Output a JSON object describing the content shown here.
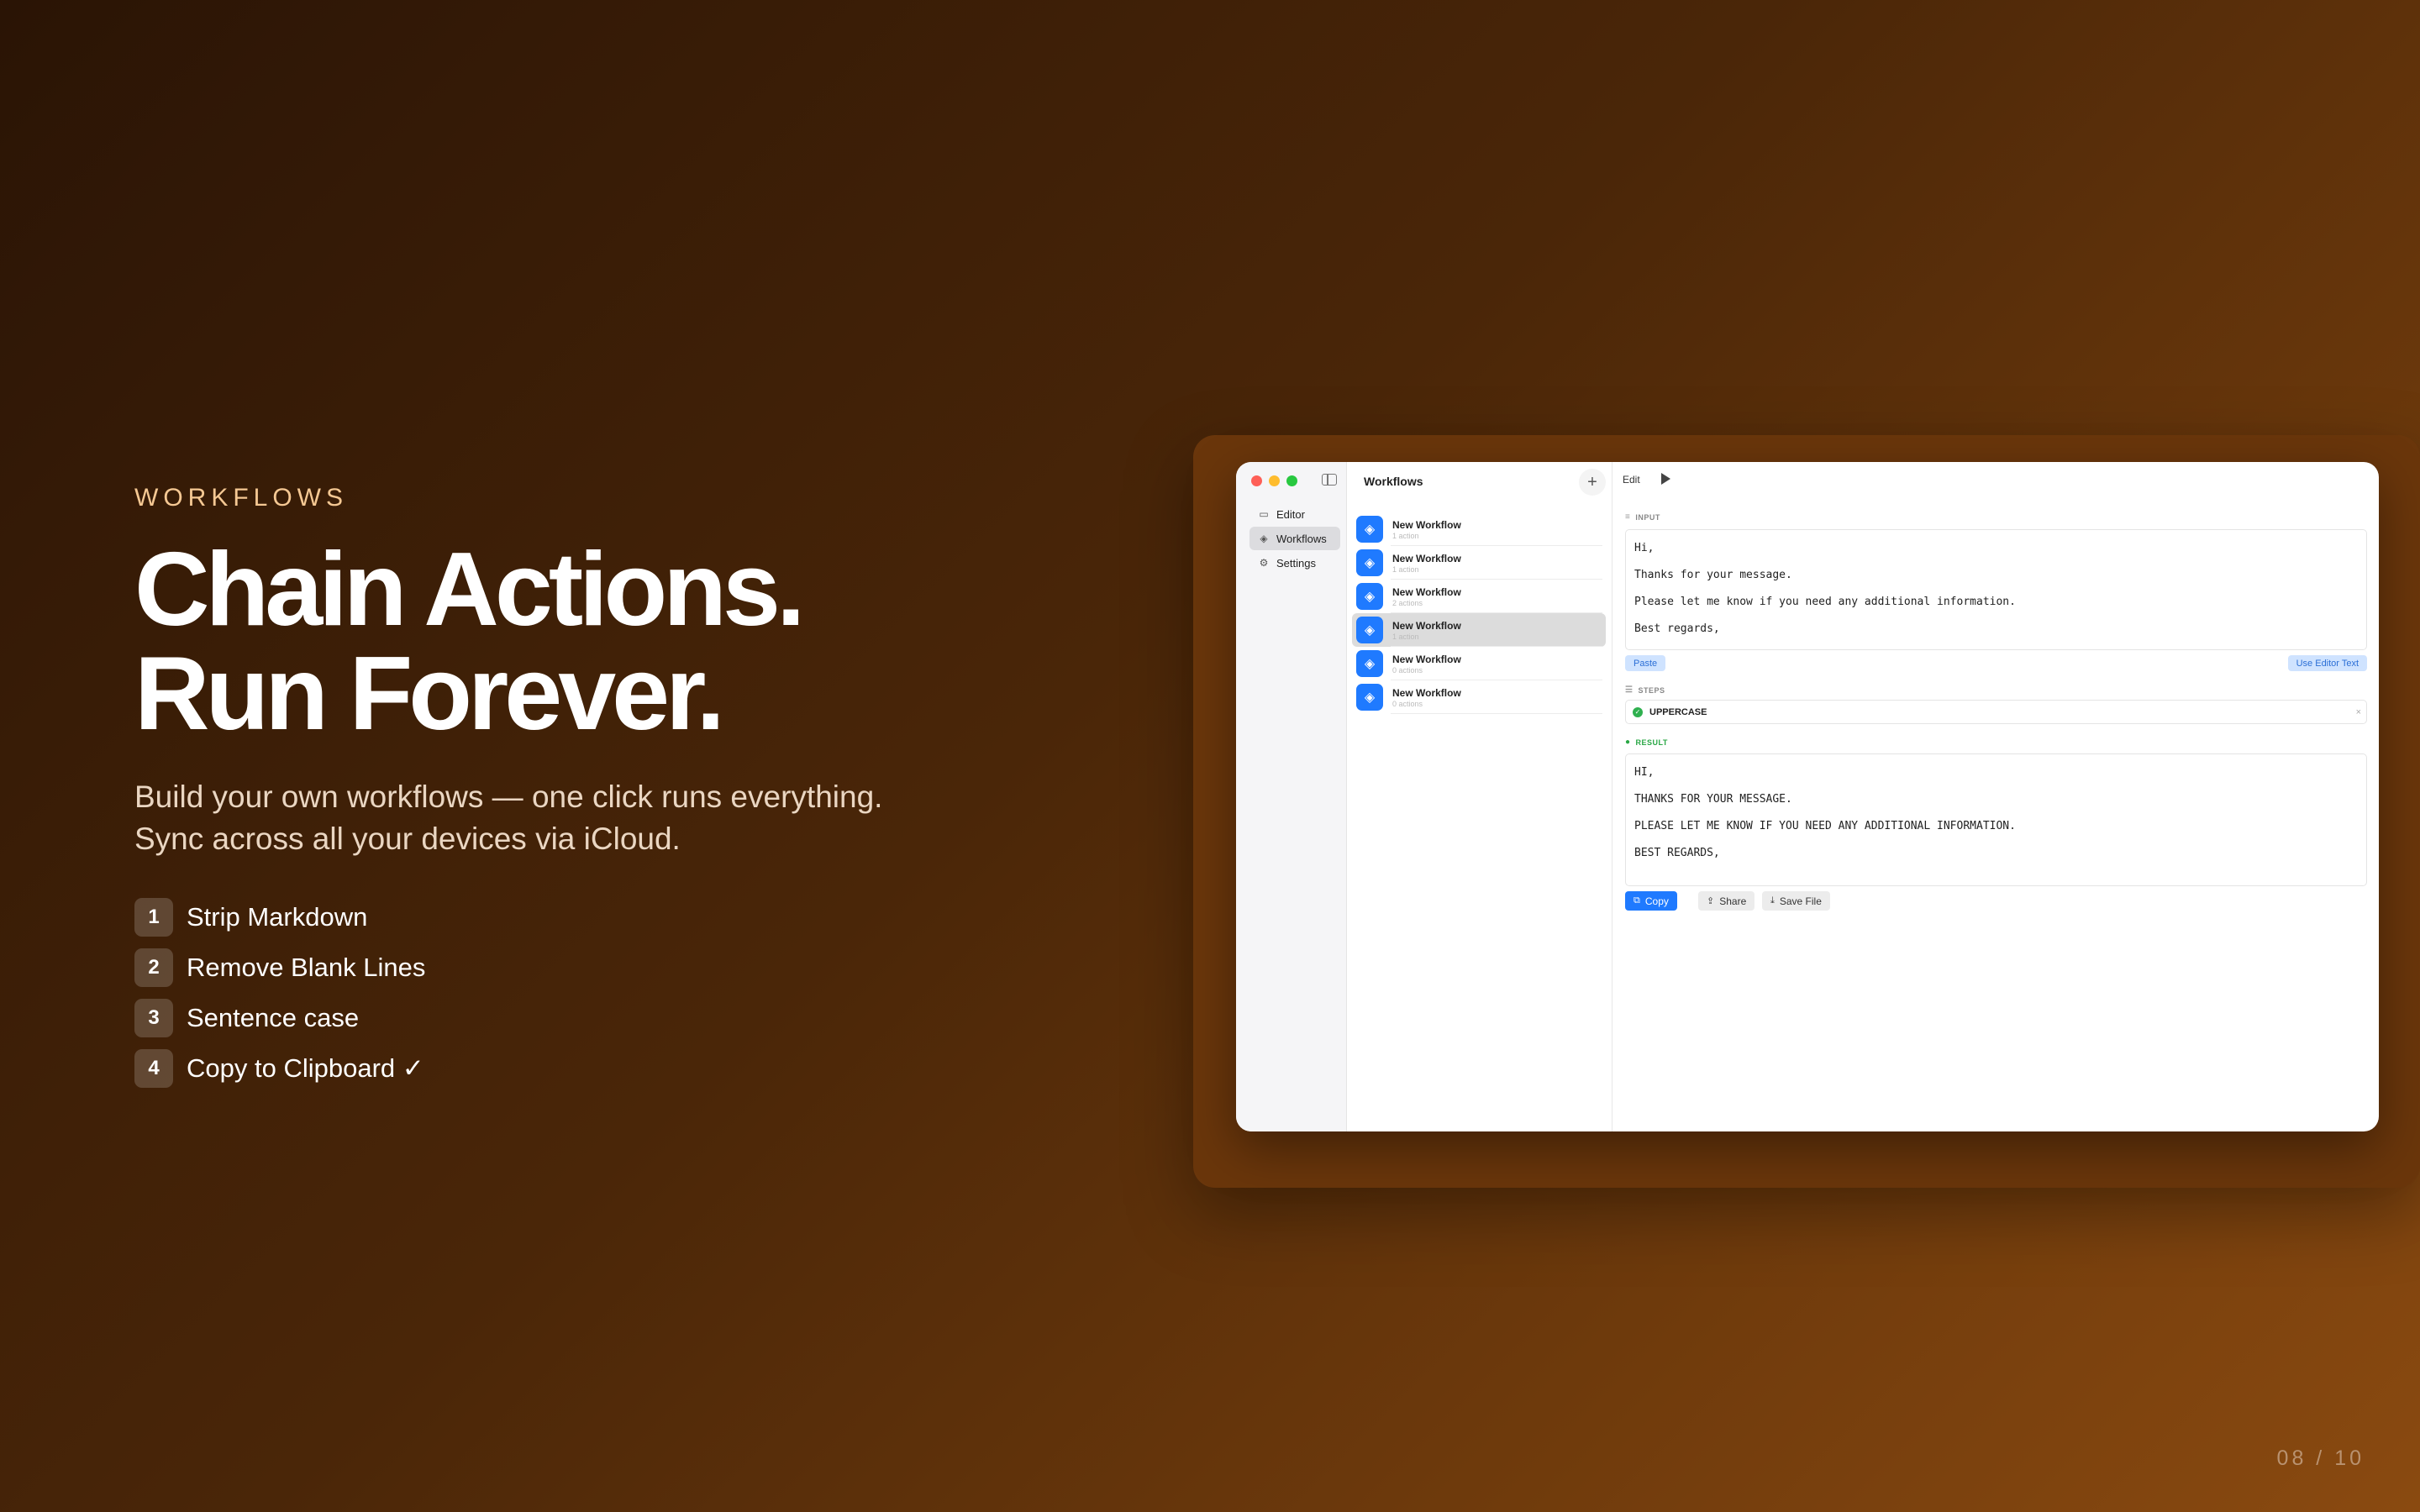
{
  "promo": {
    "eyebrow": "WORKFLOWS",
    "headline_line1": "Chain Actions.",
    "headline_line2": "Run Forever.",
    "subtitle": "Build your own workflows — one click runs everything. Sync across all your devices via iCloud.",
    "steps": [
      {
        "num": "1",
        "label": "Strip Markdown"
      },
      {
        "num": "2",
        "label": "Remove Blank Lines"
      },
      {
        "num": "3",
        "label": "Sentence case"
      },
      {
        "num": "4",
        "label": "Copy to Clipboard ✓"
      }
    ]
  },
  "page_indicator": "08 / 10",
  "app": {
    "sidebar": {
      "items": [
        {
          "label": "Editor",
          "icon": "document-icon"
        },
        {
          "label": "Workflows",
          "icon": "layers-icon"
        },
        {
          "label": "Settings",
          "icon": "gear-icon"
        }
      ]
    },
    "list": {
      "title": "Workflows",
      "add_label": "+",
      "rows": [
        {
          "name": "New Workflow",
          "sub": "1 action"
        },
        {
          "name": "New Workflow",
          "sub": "1 action"
        },
        {
          "name": "New Workflow",
          "sub": "2 actions"
        },
        {
          "name": "New Workflow",
          "sub": "1 action"
        },
        {
          "name": "New Workflow",
          "sub": "0 actions"
        },
        {
          "name": "New Workflow",
          "sub": "0 actions"
        }
      ]
    },
    "detail": {
      "edit_label": "Edit",
      "input_label": "INPUT",
      "input_lines": [
        "Hi,",
        "Thanks for your message.",
        "Please let me know if you need any additional information.",
        "Best regards,"
      ],
      "paste_label": "Paste",
      "use_editor_label": "Use Editor Text",
      "steps_label": "STEPS",
      "step_name": "UPPERCASE",
      "step_remove": "×",
      "result_label": "RESULT",
      "result_lines": [
        "HI,",
        "THANKS FOR YOUR MESSAGE.",
        "PLEASE LET ME KNOW IF YOU NEED ANY ADDITIONAL INFORMATION.",
        "BEST REGARDS,"
      ],
      "copy_label": "Copy",
      "share_label": "Share",
      "save_label": "Save File"
    }
  },
  "colors": {
    "accent": "#1f7aff",
    "eyebrow": "#f5c893",
    "success": "#29a745"
  }
}
